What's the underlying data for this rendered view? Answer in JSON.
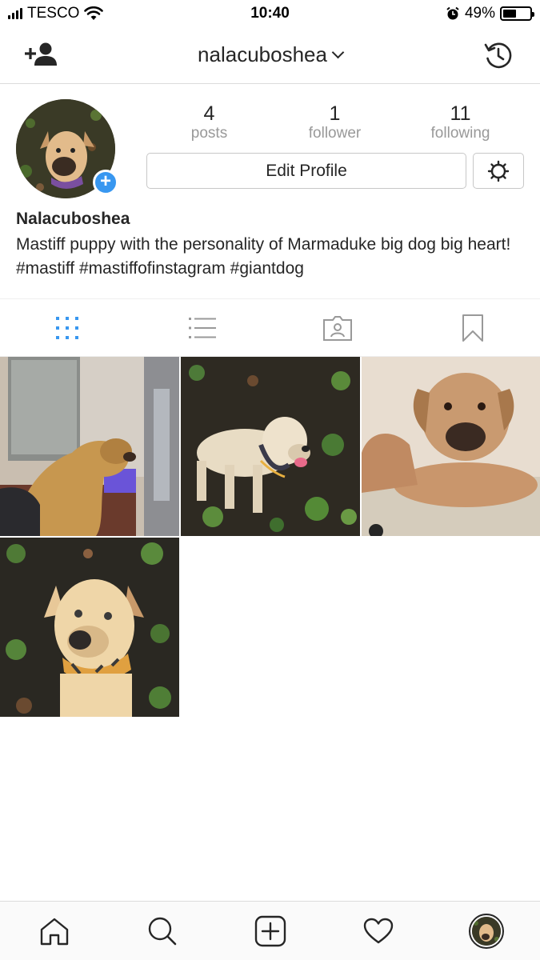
{
  "status_bar": {
    "carrier": "TESCO",
    "time": "10:40",
    "battery_percent": "49%",
    "battery_level": 0.49
  },
  "header": {
    "username": "nalacuboshea",
    "add_friend_icon": "add-person-icon",
    "archive_icon": "history-clock-icon"
  },
  "profile": {
    "stats": [
      {
        "value": "4",
        "label": "posts"
      },
      {
        "value": "1",
        "label": "follower"
      },
      {
        "value": "11",
        "label": "following"
      }
    ],
    "edit_button_label": "Edit Profile",
    "name": "Nalacuboshea",
    "bio": "Mastiff puppy with the personality of Marmaduke big dog big heart! #mastiff #mastiffofinstagram #giantdog"
  },
  "tabs": [
    {
      "name": "grid-view",
      "icon": "grid-icon",
      "active": true
    },
    {
      "name": "list-view",
      "icon": "list-icon",
      "active": false
    },
    {
      "name": "tagged",
      "icon": "tagged-photo-icon",
      "active": false
    },
    {
      "name": "saved",
      "icon": "bookmark-icon",
      "active": false
    }
  ],
  "posts": [
    {
      "description": "dog looking out window",
      "icon": "photo"
    },
    {
      "description": "dog standing on leaves",
      "icon": "photo"
    },
    {
      "description": "puppy lying on carpet",
      "icon": "photo"
    },
    {
      "description": "dog sitting with bandana",
      "icon": "photo"
    }
  ],
  "bottom_nav": [
    {
      "name": "home",
      "icon": "home-icon"
    },
    {
      "name": "search",
      "icon": "search-icon"
    },
    {
      "name": "new-post",
      "icon": "plus-square-icon"
    },
    {
      "name": "activity",
      "icon": "heart-icon"
    },
    {
      "name": "profile",
      "icon": "avatar-icon"
    }
  ],
  "colors": {
    "accent": "#3897f0",
    "text": "#262626",
    "muted": "#999999",
    "border": "#dbdbdb"
  }
}
